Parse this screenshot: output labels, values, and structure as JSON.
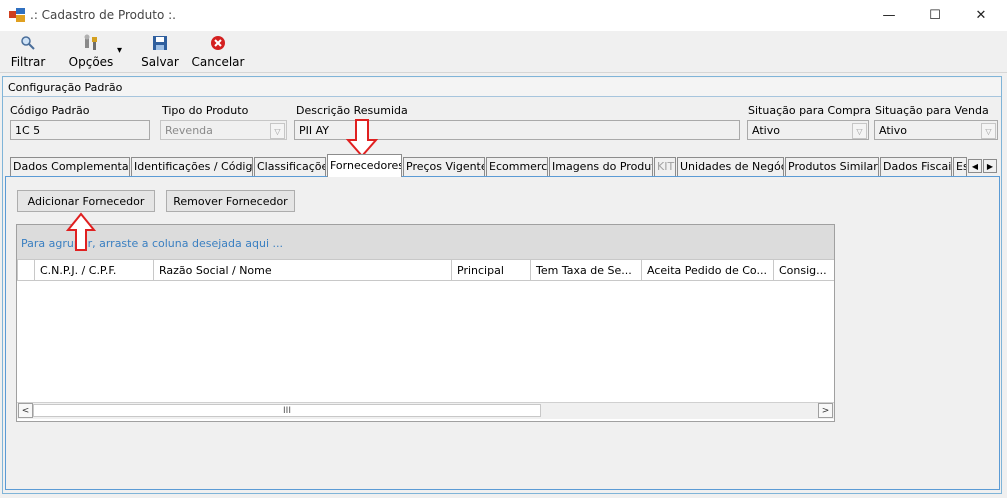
{
  "window": {
    "title": ".: Cadastro de Produto :.",
    "minimize_glyph": "—",
    "maximize_glyph": "☐",
    "close_glyph": "✕"
  },
  "toolbar": {
    "filtrar_label": "Filtrar",
    "opcoes_label": "Opções",
    "salvar_label": "Salvar",
    "cancelar_label": "Cancelar",
    "dropdown_glyph": "▾"
  },
  "config": {
    "section_title": "Configuração Padrão",
    "codigo_label": "Código Padrão",
    "codigo_value": "1C        5",
    "tipo_label": "Tipo do Produto",
    "tipo_value": "Revenda",
    "descricao_label": "Descrição Resumida",
    "descricao_value": "PII                                                                              AY",
    "compra_label": "Situação para Compra",
    "compra_value": "Ativo",
    "venda_label": "Situação para Venda",
    "venda_value": "Ativo",
    "dropdown_glyph": "▽"
  },
  "tabs": [
    {
      "label": "Dados Complementares"
    },
    {
      "label": "Identificações / Códigos"
    },
    {
      "label": "Classificações"
    },
    {
      "label": "Fornecedores"
    },
    {
      "label": "Preços Vigentes"
    },
    {
      "label": "Ecommerce"
    },
    {
      "label": "Imagens do Produto"
    },
    {
      "label": "KIT"
    },
    {
      "label": "Unidades de Negócio"
    },
    {
      "label": "Produtos Similares"
    },
    {
      "label": "Dados Fiscais"
    },
    {
      "label": "Es"
    }
  ],
  "tab_scroll": {
    "left": "◀",
    "right": "▶"
  },
  "fornecedores": {
    "add_button": "Adicionar Fornecedor",
    "remove_button": "Remover Fornecedor",
    "group_hint": "Para agrupar, arraste a coluna desejada aqui ...",
    "columns": [
      "C.N.P.J. / C.P.F.",
      "Razão Social / Nome",
      "Principal",
      "Tem Taxa de Se...",
      "Aceita Pedido de Co...",
      "Consig..."
    ],
    "scroll_left": "<",
    "scroll_right": ">",
    "scroll_thumb": "III"
  },
  "colors": {
    "accent_border": "#5b9bd5",
    "group_hint_text": "#3a7fc1",
    "annotation_arrow": "#e02020"
  }
}
